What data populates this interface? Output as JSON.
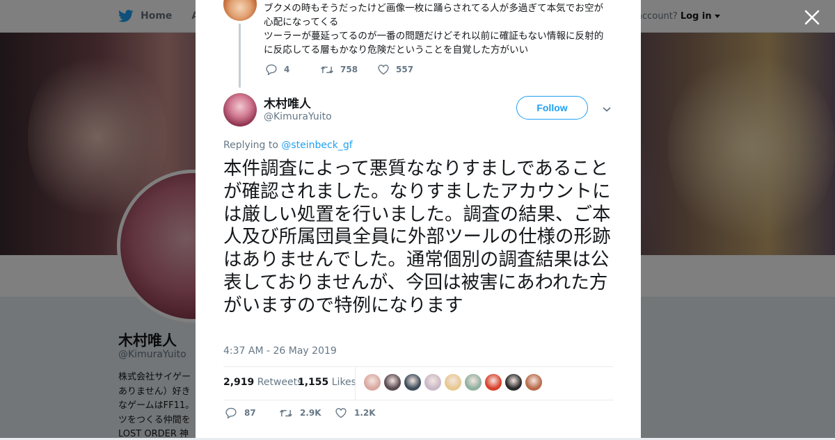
{
  "background": {
    "nav": {
      "home_label": "Home",
      "about_label": "Abo"
    },
    "login": {
      "prefix": "account?",
      "label": "Log in"
    },
    "profile": {
      "name": "木村唯人",
      "handle": "@KimuraYuito",
      "bio": "株式会社サイゲー\nありません）好き\nなゲームはFF11。\nツをつくる仲間を\nLOST ORDER 神"
    }
  },
  "modal": {
    "previous_tweet": {
      "lines": [
        "ブクメの時もそうだったけど画像一枚に踊らされてる人が多過ぎて本気でお空が心配になってくる",
        "ツーラーが蔓延ってるのが一番の問題だけどそれ以前に確証もない情報に反射的に反応してる層もかなり危険だということを自覚した方がいい"
      ],
      "replies": "4",
      "retweets": "758",
      "likes": "557"
    },
    "tweet": {
      "author_name": "木村唯人",
      "author_handle": "@KimuraYuito",
      "follow_label": "Follow",
      "replying_prefix": "Replying to",
      "replying_to": "@steinbeck_gf",
      "text": "本件調査によって悪質ななりすましであることが確認されました。なりすましたアカウントには厳しい処置を行いました。調査の結果、ご本人及び所属団員全員に外部ツールの仕様の形跡はありませんでした。通常個別の調査結果は公表しておりませんが、今回は被害にあわれた方がいますので特例になります",
      "timestamp": "4:37 AM - 26 May 2019",
      "retweet_count": "2,919",
      "retweet_label": "Retweets",
      "like_count": "1,155",
      "like_label": "Likes",
      "action_replies": "87",
      "action_retweets": "2.9K",
      "action_likes": "1.2K"
    },
    "liker_colors": [
      "#d9a8a0",
      "#5a4a52",
      "#3c4c5a",
      "#c8b8c8",
      "#e8c890",
      "#8fb0a0",
      "#d8402a",
      "#2a2a2a",
      "#b86a4a"
    ]
  },
  "icons": [
    "twitter-bird-icon",
    "caret-down-icon",
    "close-icon",
    "reply-icon",
    "retweet-icon",
    "heart-icon",
    "chevron-down-icon"
  ],
  "colors": {
    "accent": "#1da1f2",
    "text": "#14171a",
    "muted": "#657786"
  }
}
